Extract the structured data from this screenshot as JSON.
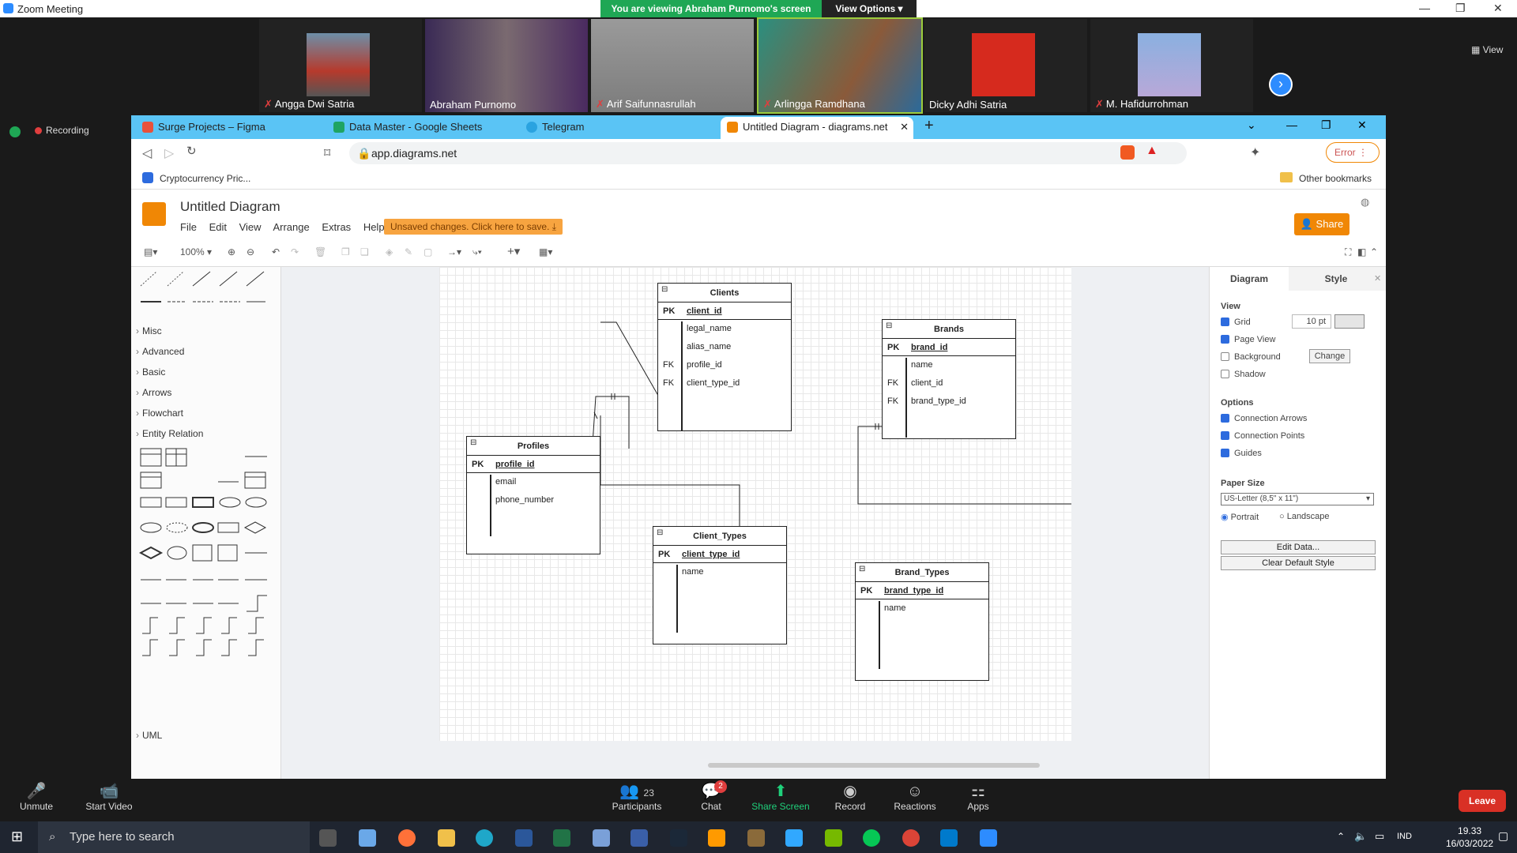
{
  "zoom": {
    "window_title": "Zoom Meeting",
    "banner": "You are viewing Abraham Purnomo's screen",
    "view_options": "View Options",
    "view_label": "View",
    "recording": "Recording",
    "participants_tiles": [
      {
        "name": "Angga Dwi Satria",
        "muted": true
      },
      {
        "name": "Abraham Purnomo",
        "muted": false
      },
      {
        "name": "Arif Saifunnasrullah",
        "muted": true
      },
      {
        "name": "Arlingga Ramdhana",
        "muted": true
      },
      {
        "name": "Dicky Adhi Satria",
        "muted": false
      },
      {
        "name": "M. Hafidurrohman",
        "muted": true
      }
    ],
    "bottom": {
      "unmute": "Unmute",
      "start_video": "Start Video",
      "participants": "Participants",
      "participants_count": "23",
      "chat": "Chat",
      "chat_badge": "2",
      "share_screen": "Share Screen",
      "record": "Record",
      "reactions": "Reactions",
      "apps": "Apps",
      "leave": "Leave"
    }
  },
  "browser": {
    "tabs": [
      {
        "label": "Surge Projects – Figma",
        "color": "#e8513b"
      },
      {
        "label": "Data Master - Google Sheets",
        "color": "#1fa463"
      },
      {
        "label": "Telegram",
        "color": "#2aa3e0"
      },
      {
        "label": "Untitled Diagram - diagrams.net",
        "color": "#f08705"
      }
    ],
    "url": "app.diagrams.net",
    "bookmark": "Cryptocurrency Pric...",
    "other_bookmarks": "Other bookmarks",
    "error_btn": "Error"
  },
  "drawio": {
    "title": "Untitled Diagram",
    "menus": [
      "File",
      "Edit",
      "View",
      "Arrange",
      "Extras",
      "Help"
    ],
    "unsaved": "Unsaved changes. Click here to save.",
    "share": "Share",
    "zoom": "100%",
    "sections": [
      "Misc",
      "Advanced",
      "Basic",
      "Arrows",
      "Flowchart",
      "Entity Relation",
      "UML"
    ],
    "format": {
      "tab_diagram": "Diagram",
      "tab_style": "Style",
      "view_heading": "View",
      "grid": "Grid",
      "grid_size": "10 pt",
      "page_view": "Page View",
      "background": "Background",
      "change": "Change",
      "shadow": "Shadow",
      "options_heading": "Options",
      "connection_arrows": "Connection Arrows",
      "connection_points": "Connection Points",
      "guides": "Guides",
      "paper_size_heading": "Paper Size",
      "paper_size": "US-Letter (8,5\" x 11\")",
      "portrait": "Portrait",
      "landscape": "Landscape",
      "edit_data": "Edit Data...",
      "clear_default_style": "Clear Default Style"
    },
    "tables": {
      "clients": {
        "title": "Clients",
        "pk": "client_id",
        "rows": [
          [
            "",
            "legal_name"
          ],
          [
            "",
            "alias_name"
          ],
          [
            "FK",
            "profile_id"
          ],
          [
            "FK",
            "client_type_id"
          ]
        ]
      },
      "brands": {
        "title": "Brands",
        "pk": "brand_id",
        "rows": [
          [
            "",
            "name"
          ],
          [
            "FK",
            "client_id"
          ],
          [
            "FK",
            "brand_type_id"
          ]
        ]
      },
      "profiles": {
        "title": "Profiles",
        "pk": "profile_id",
        "rows": [
          [
            "",
            "email"
          ],
          [
            "",
            "phone_number"
          ]
        ]
      },
      "client_types": {
        "title": "Client_Types",
        "pk": "client_type_id",
        "rows": [
          [
            "",
            "name"
          ]
        ]
      },
      "brand_types": {
        "title": "Brand_Types",
        "pk": "brand_type_id",
        "rows": [
          [
            "",
            "name"
          ]
        ]
      }
    },
    "pk_label": "PK"
  },
  "taskbar": {
    "search_placeholder": "Type here to search",
    "lang": "IND",
    "time": "19.33",
    "date": "16/03/2022"
  }
}
